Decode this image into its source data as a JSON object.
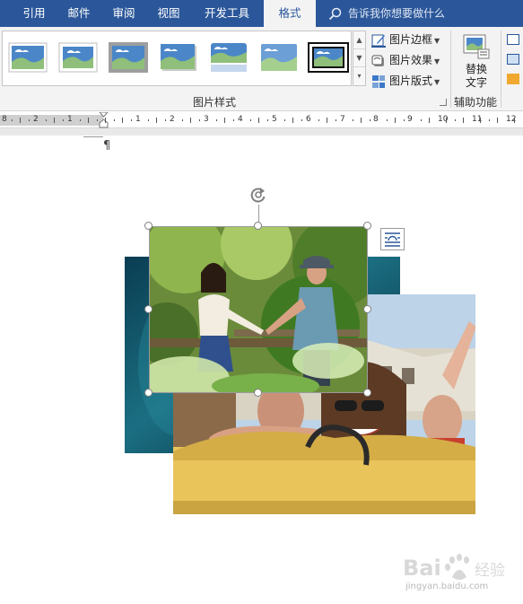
{
  "tabs": [
    {
      "label": "引用",
      "active": false
    },
    {
      "label": "邮件",
      "active": false
    },
    {
      "label": "审阅",
      "active": false
    },
    {
      "label": "视图",
      "active": false
    },
    {
      "label": "开发工具",
      "active": false
    },
    {
      "label": "格式",
      "active": true
    }
  ],
  "tell_me": {
    "icon": "search-icon",
    "placeholder": "告诉我你想要做什么"
  },
  "picture_styles": {
    "group_label": "图片样式",
    "gallery_count": 7,
    "selected_index": 6,
    "commands": [
      {
        "label": "图片边框",
        "icon": "picture-border-icon"
      },
      {
        "label": "图片效果",
        "icon": "picture-effects-icon"
      },
      {
        "label": "图片版式",
        "icon": "picture-layout-icon"
      }
    ]
  },
  "accessibility": {
    "group_label": "辅助功能",
    "alt_text_label_line1": "替换",
    "alt_text_label_line2": "文字"
  },
  "ruler": {
    "left_labels": [
      "8",
      "2",
      "1"
    ],
    "right_labels": [
      "1",
      "2",
      "3",
      "4",
      "5",
      "6",
      "7",
      "8",
      "9",
      "10",
      "11",
      "12"
    ]
  },
  "document": {
    "paragraph_mark": "¶",
    "pictures": [
      {
        "name": "teal-background-picture"
      },
      {
        "name": "bus-tour-picture"
      },
      {
        "name": "couple-picture",
        "selected": true
      }
    ]
  },
  "watermark": {
    "brand": "Bai",
    "brand_suffix": "经验",
    "url": "jingyan.baidu.com"
  },
  "colors": {
    "tabbar": "#2b579a",
    "ribbon": "#f3f3f3",
    "selection_border": "#9a9a9a"
  }
}
